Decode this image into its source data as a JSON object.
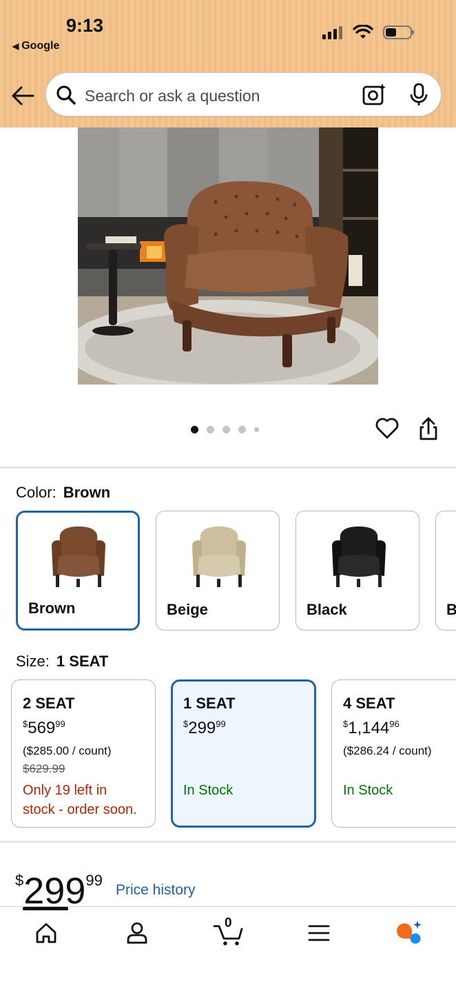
{
  "status_bar": {
    "time": "9:13",
    "back_app": "Google"
  },
  "search": {
    "placeholder": "Search or ask a question"
  },
  "product": {
    "image_alt": "Brown tufted leather armchair",
    "image_dots": 5,
    "active_dot": 0
  },
  "color": {
    "label": "Color:",
    "selected": "Brown",
    "options": [
      {
        "name": "Brown",
        "selected": true,
        "color": "#7a4a2e"
      },
      {
        "name": "Beige",
        "selected": false,
        "color": "#cdbf9e"
      },
      {
        "name": "Black",
        "selected": false,
        "color": "#1c1c1c"
      },
      {
        "name": "B",
        "selected": false,
        "color": "#555555"
      }
    ]
  },
  "size": {
    "label": "Size:",
    "selected": "1 SEAT",
    "options": [
      {
        "title": "2 SEAT",
        "price_symbol": "$",
        "price_whole": "569",
        "price_cents": "99",
        "unit_price": "($285.00 / count)",
        "list_price": "$629.99",
        "availability": "Only 19 left in stock - order soon.",
        "availability_line1": "Only 19 left in",
        "availability_line2": "stock - order soon.",
        "selected": false
      },
      {
        "title": "1 SEAT",
        "price_symbol": "$",
        "price_whole": "299",
        "price_cents": "99",
        "availability": "In Stock",
        "selected": true
      },
      {
        "title": "4 SEAT",
        "price_symbol": "$",
        "price_whole": "1,144",
        "price_cents": "96",
        "unit_price": "($286.24 / count)",
        "availability": "In Stock",
        "selected": false
      }
    ]
  },
  "price": {
    "symbol": "$",
    "whole": "299",
    "cents": "99",
    "history_link": "Price history"
  },
  "bottom_nav": {
    "items": [
      "home-icon",
      "account-icon",
      "cart-icon",
      "menu-icon",
      "rufus-icon"
    ],
    "cart_count": "0"
  },
  "colors": {
    "accent": "#2162a1",
    "in_stock": "#007600",
    "low_stock": "#b12704",
    "header": "#f3c590"
  }
}
